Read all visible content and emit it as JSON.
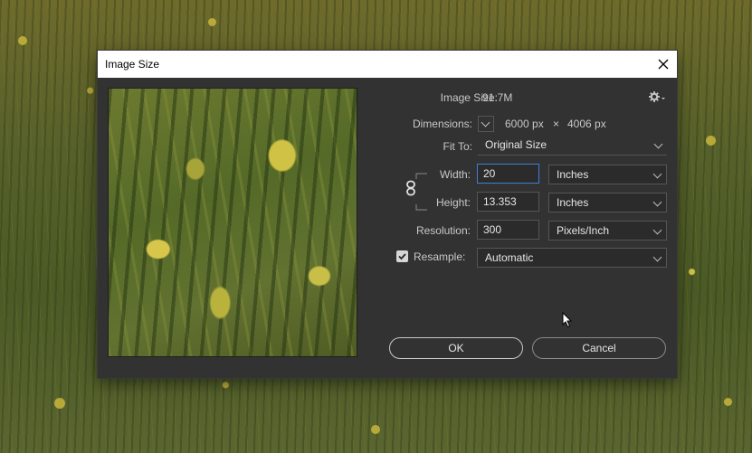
{
  "dialog": {
    "title": "Image Size"
  },
  "info": {
    "image_size_label": "Image Size:",
    "image_size_value": "91.7M",
    "dimensions_label": "Dimensions:",
    "dimensions_width": "6000 px",
    "dimensions_times": "×",
    "dimensions_height": "4006 px"
  },
  "fit_to": {
    "label": "Fit To:",
    "value": "Original Size"
  },
  "width": {
    "label": "Width:",
    "value": "20",
    "unit": "Inches"
  },
  "height": {
    "label": "Height:",
    "value": "13.353",
    "unit": "Inches"
  },
  "resolution": {
    "label": "Resolution:",
    "value": "300",
    "unit": "Pixels/Inch"
  },
  "resample": {
    "label": "Resample:",
    "checked": true,
    "value": "Automatic"
  },
  "buttons": {
    "ok": "OK",
    "cancel": "Cancel"
  },
  "icons": {
    "close": "close-icon",
    "gear": "gear-icon",
    "chevron": "chevron-down-icon",
    "link": "link-icon",
    "check": "check-icon",
    "cursor": "mouse-cursor-icon"
  },
  "colors": {
    "dialog_bg": "#323232",
    "accent_focus": "#3f7fd4"
  }
}
